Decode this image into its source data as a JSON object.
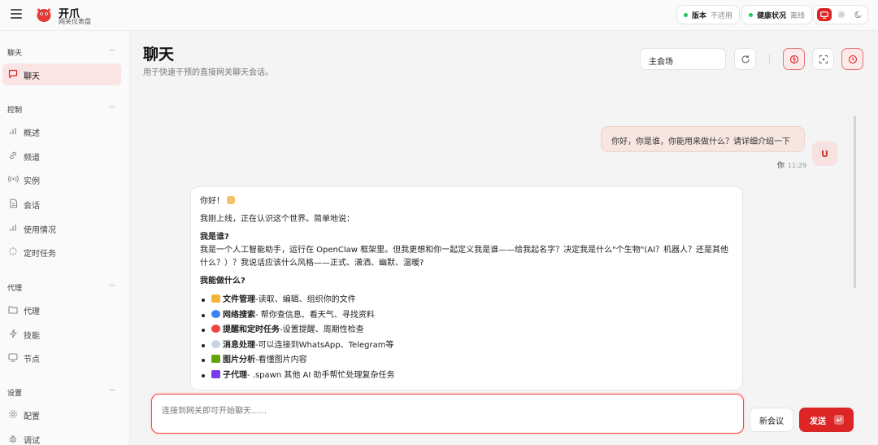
{
  "brand": {
    "title": "开爪",
    "subtitle": "网关仪表盘"
  },
  "status": {
    "version": {
      "label": "版本",
      "value": "不适用"
    },
    "health": {
      "label": "健康状况",
      "value": "离线"
    }
  },
  "sidebar": {
    "sections": [
      {
        "title": "聊天",
        "items": [
          {
            "label": "聊天",
            "icon": "message-icon",
            "active": true
          }
        ]
      },
      {
        "title": "控制",
        "items": [
          {
            "label": "概述",
            "icon": "bar-chart-icon"
          },
          {
            "label": "频道",
            "icon": "link-icon"
          },
          {
            "label": "实例",
            "icon": "broadcast-icon"
          },
          {
            "label": "会话",
            "icon": "document-icon"
          },
          {
            "label": "使用情况",
            "icon": "bar-chart-icon"
          },
          {
            "label": "定时任务",
            "icon": "loader-icon"
          }
        ]
      },
      {
        "title": "代理",
        "items": [
          {
            "label": "代理",
            "icon": "folder-icon"
          },
          {
            "label": "技能",
            "icon": "lightning-icon"
          },
          {
            "label": "节点",
            "icon": "monitor-icon"
          }
        ]
      },
      {
        "title": "设置",
        "items": [
          {
            "label": "配置",
            "icon": "gear-icon"
          },
          {
            "label": "调试",
            "icon": "bug-icon"
          }
        ]
      }
    ]
  },
  "header": {
    "title": "聊天",
    "subtitle": "用于快速干预的直接网关聊天会话。",
    "session_value": "主会场"
  },
  "messages": {
    "user": {
      "text": "你好，你是谁，你能用来做什么？请详细介绍一下",
      "avatar": "U",
      "sender": "你",
      "time": "11:29"
    },
    "assistant": {
      "greeting": "你好！",
      "intro": "我刚上线，正在认识这个世界。简单地说：",
      "who_heading": "我是谁?",
      "who_body": "我是一个人工智能助手，运行在 OpenClaw 框架里。但我更想和你一起定义我是谁——给我起名字？决定我是什么\"个生物\"(AI？机器人？还是其他什么？）？我说话应该什么风格——正式、潇洒、幽默、温暖?",
      "can_heading": "我能做什么?",
      "abilities": [
        {
          "name": "文件管理",
          "desc": "-读取、编辑、组织你的文件",
          "color": "#f5b335"
        },
        {
          "name": "网络搜索",
          "desc": "- 帮你查信息、看天气、寻找资料",
          "color": "#3b82f6"
        },
        {
          "name": "提醒和定时任务",
          "desc": "-设置提醒、周期性检查",
          "color": "#ef4444"
        },
        {
          "name": "消息处理",
          "desc": "-可以连接到WhatsApp、Telegram等",
          "color": "#cbd5e1"
        },
        {
          "name": "图片分析",
          "desc": "-看懂图片内容",
          "color": "#65a30d"
        },
        {
          "name": "子代理",
          "desc": "- .spawn 其他 AI 助手帮忙处理复杂任务",
          "color": "#7c3aed"
        }
      ]
    }
  },
  "composer": {
    "placeholder": "连接到网关即可开始聊天......",
    "new_session_label": "新会议",
    "send_label": "发送"
  },
  "colors": {
    "accent": "#dc2626",
    "accent_soft": "#fbe4e4",
    "online": "#22c55e"
  }
}
